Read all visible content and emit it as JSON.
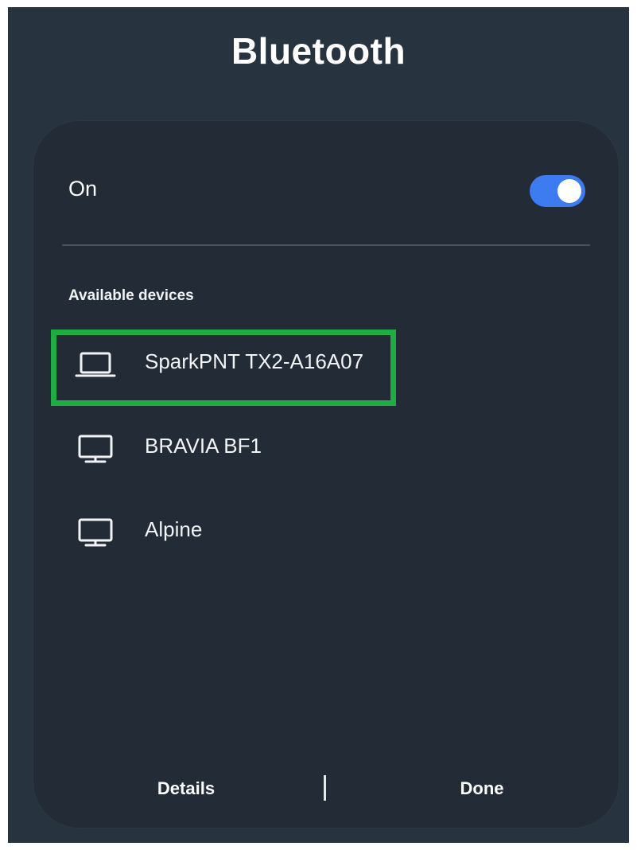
{
  "dialog": {
    "title": "Bluetooth",
    "toggle_label": "On",
    "toggle_state": "on",
    "section_title": "Available devices"
  },
  "devices": [
    {
      "name": "SparkPNT TX2-A16A07",
      "icon": "laptop-icon",
      "highlighted": true
    },
    {
      "name": "BRAVIA BF1",
      "icon": "monitor-icon",
      "highlighted": false
    },
    {
      "name": "Alpine",
      "icon": "monitor-icon",
      "highlighted": false
    }
  ],
  "footer": {
    "details_label": "Details",
    "done_label": "Done"
  },
  "colors": {
    "background": "#283340",
    "card": "#222b36",
    "toggle_on": "#3c7bf0",
    "highlight": "#1fad43"
  }
}
